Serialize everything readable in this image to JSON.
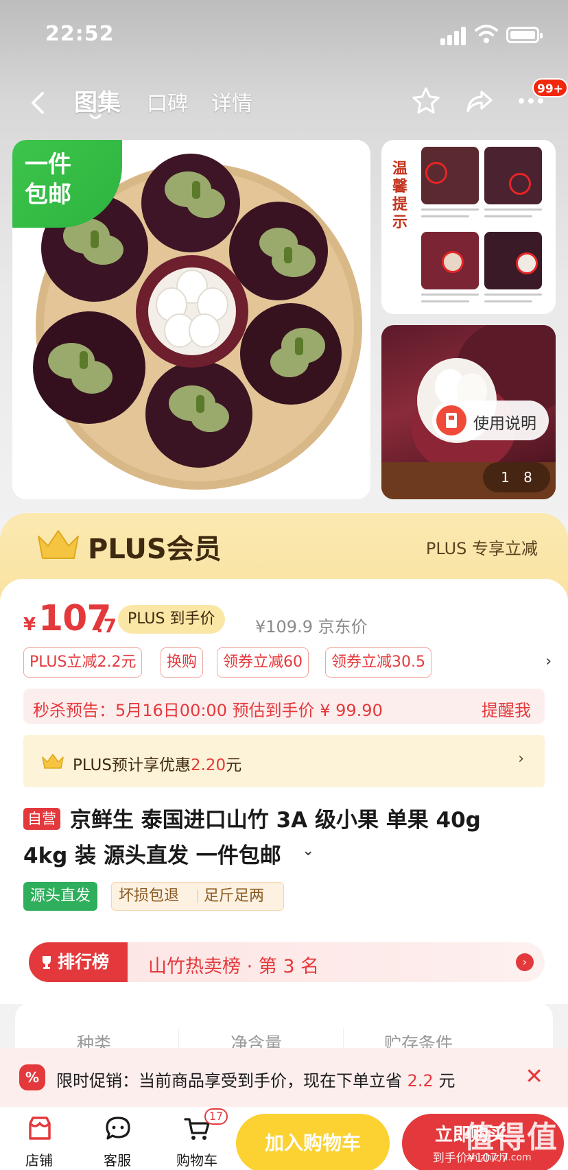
{
  "status": {
    "time": "22:52"
  },
  "nav": {
    "tabs": [
      "图集",
      "口碑",
      "详情"
    ],
    "badge": "99+"
  },
  "gallery": {
    "free_shipping_tag": [
      "一件",
      "包邮"
    ],
    "tip_title": "温馨提示",
    "usage_label": "使用说明",
    "page_counter": "1 8"
  },
  "plus_banner": {
    "title": "PLUS会员",
    "exclusive": "PLUS 专享立减"
  },
  "price": {
    "symbol": "¥",
    "integer": "107",
    "decimal": ".7",
    "plus_tag": "PLUS 到手价",
    "jd_price": "¥109.9 京东价"
  },
  "promos": [
    "PLUS立减2.2元",
    "换购",
    "领券立减60",
    "领券立减30.5"
  ],
  "flash_sale": {
    "text": "秒杀预告：5月16日00:00 预估到手价 ¥ 99.90",
    "remind": "提醒我"
  },
  "plus_save": {
    "prefix": "PLUS预计享优惠",
    "amount": "2.20",
    "suffix": "元"
  },
  "product": {
    "self_tag": "自营",
    "title_line1": "京鲜生 泰国进口山竹 3A 级小果 单果 40g",
    "title_line2": "4kg 装  源头直发 一件包邮",
    "features": [
      "源头直发",
      "坏损包退",
      "足斤足两"
    ]
  },
  "ranking": {
    "badge": "排行榜",
    "text": "山竹热卖榜 · 第 3 名"
  },
  "specs": [
    "种类",
    "净含量",
    "贮存条件"
  ],
  "toast": {
    "prefix": "限时促销：当前商品享受到手价，现在下单立省",
    "amount": "2.2",
    "suffix": " 元"
  },
  "bottom_bar": {
    "store": "店铺",
    "service": "客服",
    "cart": "购物车",
    "cart_count": "17",
    "add_cart": "加入购物车",
    "buy_now": "立即购买",
    "buy_sub": "到手价¥107.7"
  },
  "watermark": {
    "big": "值得值",
    "small": "zhizhizhi.com"
  },
  "colors": {
    "accent": "#e4393c",
    "plus_gold": "#fbe7a5",
    "add_cart": "#fbd232",
    "green": "#2fae5c"
  }
}
